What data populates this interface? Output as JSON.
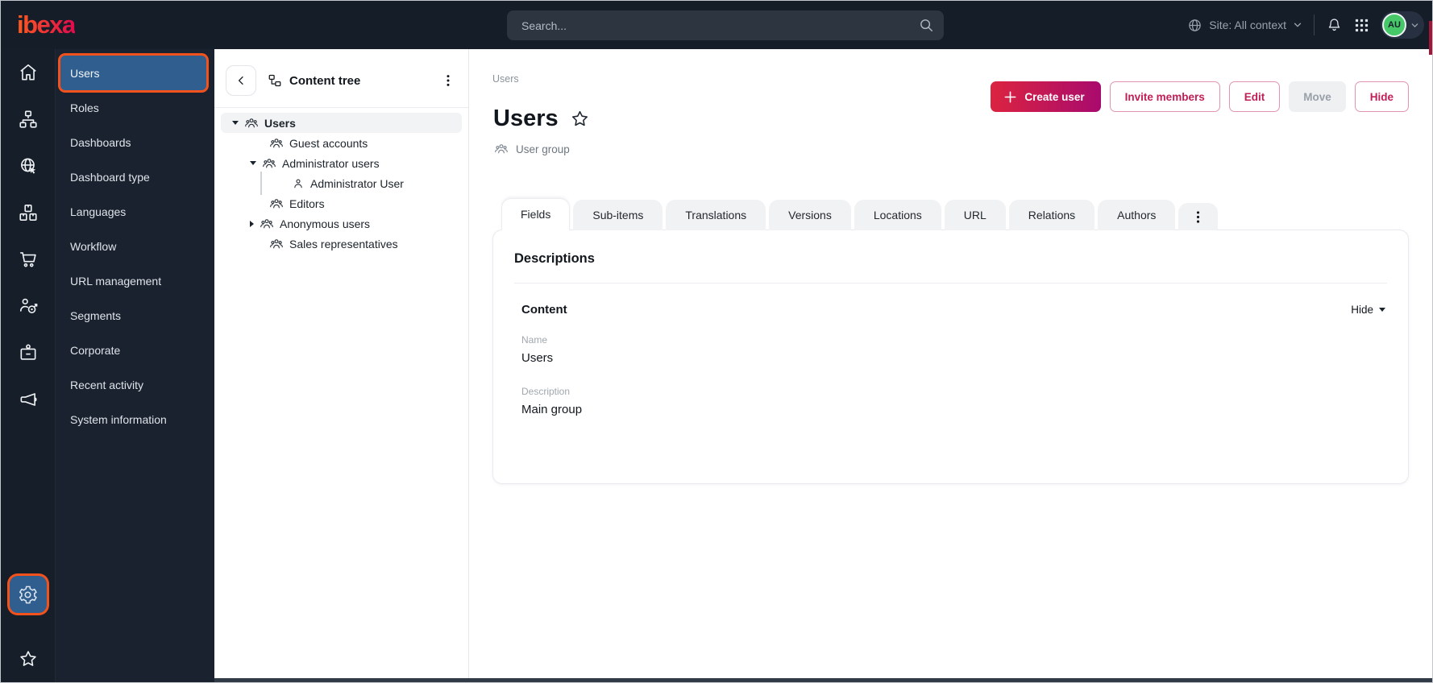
{
  "colors": {
    "topbar_bg": "#151d28",
    "rail_bg": "#161e29",
    "sidebar_bg": "#1a2230",
    "active_blue": "#2f5e8f",
    "annotation_orange": "#f4521d",
    "accent_pink": "#c11d56",
    "accent_border": "#e294b3",
    "create_grad_start": "#dc2440",
    "create_grad_end": "#a80a6e",
    "avatar_green": "#46c768",
    "logo_grad_start": "#ff5a1f",
    "logo_grad_end": "#e00a4e",
    "scroll_thumb_red": "#a11638"
  },
  "topbar": {
    "logo_text": "ibexa",
    "search_placeholder": "Search...",
    "search_icon": "search-icon",
    "site_context_label": "Site: All context",
    "site_context_icon": "globe-icon",
    "icons": [
      "bell-icon",
      "app-grid-icon"
    ],
    "avatar_initials": "AU"
  },
  "rail": {
    "items": [
      {
        "icon": "home-icon"
      },
      {
        "icon": "content-structure-icon"
      },
      {
        "icon": "site-globe-cursor-icon"
      },
      {
        "icon": "product-catalog-boxes-icon"
      },
      {
        "icon": "commerce-cart-icon"
      },
      {
        "icon": "personalization-target-icon"
      },
      {
        "icon": "corporate-badge-icon"
      },
      {
        "icon": "marketing-megaphone-icon"
      }
    ],
    "bottom_items": [
      {
        "icon": "settings-gear-icon",
        "active": true,
        "annotated": true
      },
      {
        "icon": "bookmarks-star-icon"
      }
    ]
  },
  "sidebar": {
    "items": [
      {
        "label": "Users",
        "active": true,
        "annotated": true
      },
      {
        "label": "Roles"
      },
      {
        "label": "Dashboards"
      },
      {
        "label": "Dashboard type"
      },
      {
        "label": "Languages"
      },
      {
        "label": "Workflow"
      },
      {
        "label": "URL management"
      },
      {
        "label": "Segments"
      },
      {
        "label": "Corporate"
      },
      {
        "label": "Recent activity"
      },
      {
        "label": "System information"
      }
    ]
  },
  "content_tree": {
    "title": "Content tree",
    "header_icons": [
      "collapse-left-icon",
      "tree-icon",
      "kebab-menu-icon"
    ],
    "items": [
      {
        "label": "Users",
        "icon": "user-group-icon",
        "caret": "down",
        "level": 0,
        "selected": true
      },
      {
        "label": "Guest accounts",
        "icon": "user-group-icon",
        "caret": "none",
        "level": 1
      },
      {
        "label": "Administrator users",
        "icon": "user-group-icon",
        "caret": "down",
        "level": 1
      },
      {
        "label": "Administrator User",
        "icon": "user-icon",
        "caret": "none",
        "level": 2
      },
      {
        "label": "Editors",
        "icon": "user-group-icon",
        "caret": "none",
        "level": 1
      },
      {
        "label": "Anonymous users",
        "icon": "user-group-icon",
        "caret": "right",
        "level": 1
      },
      {
        "label": "Sales representatives",
        "icon": "user-group-icon",
        "caret": "none",
        "level": 1
      }
    ]
  },
  "main": {
    "breadcrumb": "Users",
    "title": "Users",
    "title_icon": "favorite-star-icon",
    "content_type": "User group",
    "content_type_icon": "user-group-icon",
    "actions": {
      "create_label": "Create user",
      "invite_label": "Invite members",
      "edit_label": "Edit",
      "move_label": "Move",
      "move_disabled": true,
      "hide_label": "Hide"
    },
    "tabs": [
      {
        "label": "Fields",
        "active": true
      },
      {
        "label": "Sub-items"
      },
      {
        "label": "Translations"
      },
      {
        "label": "Versions"
      },
      {
        "label": "Locations"
      },
      {
        "label": "URL"
      },
      {
        "label": "Relations"
      },
      {
        "label": "Authors"
      }
    ],
    "tabs_more_icon": "kebab-menu-icon",
    "panel": {
      "heading": "Descriptions",
      "group_label": "Content",
      "collapse_label": "Hide",
      "fields": [
        {
          "label": "Name",
          "value": "Users"
        },
        {
          "label": "Description",
          "value": "Main group"
        }
      ]
    }
  }
}
